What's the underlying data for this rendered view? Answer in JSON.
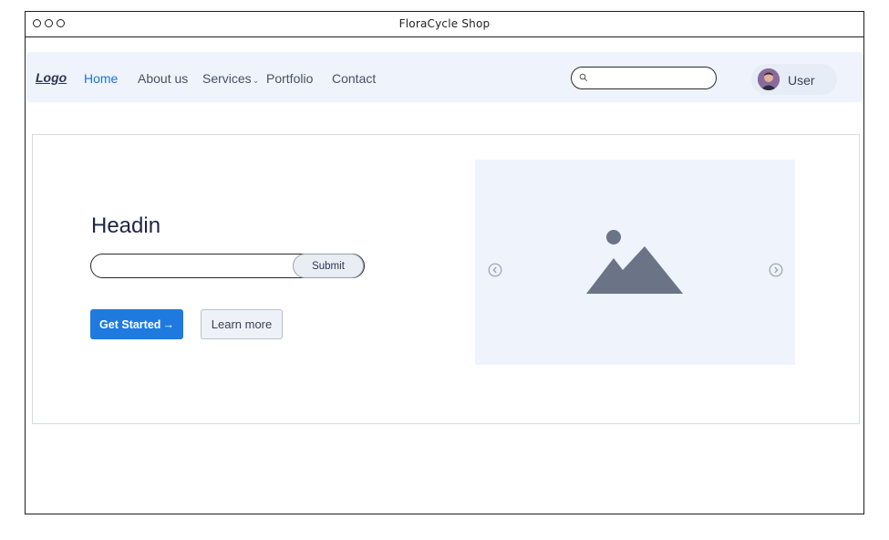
{
  "window": {
    "title": "FloraCycle Shop"
  },
  "nav": {
    "logo": "Logo",
    "items": [
      {
        "label": "Home"
      },
      {
        "label": "About us"
      },
      {
        "label": "Services"
      },
      {
        "label": "Portfolio"
      },
      {
        "label": "Contact"
      }
    ],
    "search_placeholder": "",
    "user_label": "User"
  },
  "hero": {
    "heading": "Headin",
    "form_value": "",
    "submit_label": "Submit",
    "primary_label": "Get Started",
    "primary_arrow": "→",
    "secondary_label": "Learn more"
  },
  "colors": {
    "accent": "#1f7ae0",
    "nav_active": "#1f72d4",
    "nav_bg": "#eef3fc",
    "placeholder_gray": "#6b7386"
  },
  "icons": {
    "search": "search-icon",
    "services_dropdown": "chevron-down-icon",
    "carousel_prev": "chevron-left-circle-icon",
    "carousel_next": "chevron-right-circle-icon",
    "image_placeholder": "image-placeholder-icon"
  }
}
